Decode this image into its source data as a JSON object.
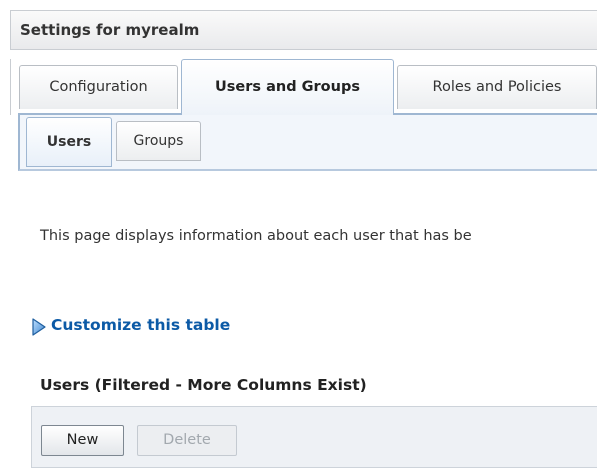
{
  "header": {
    "title": "Settings for myrealm"
  },
  "tabs": [
    {
      "label": "Configuration",
      "active": false
    },
    {
      "label": "Users and Groups",
      "active": true
    },
    {
      "label": "Roles and Policies",
      "active": false
    }
  ],
  "subtabs": [
    {
      "label": "Users",
      "active": true
    },
    {
      "label": "Groups",
      "active": false
    }
  ],
  "description": "This page displays information about each user that has be",
  "customize": {
    "label": "Customize this table",
    "icon": "disclosure-triangle-icon"
  },
  "table": {
    "title": "Users (Filtered - More Columns Exist)",
    "buttons": {
      "new_label": "New",
      "delete_label": "Delete"
    }
  },
  "colors": {
    "link": "#0c5aa6",
    "active_tab_border": "#9fb7d2",
    "panel_bg": "#f2f6fb"
  }
}
